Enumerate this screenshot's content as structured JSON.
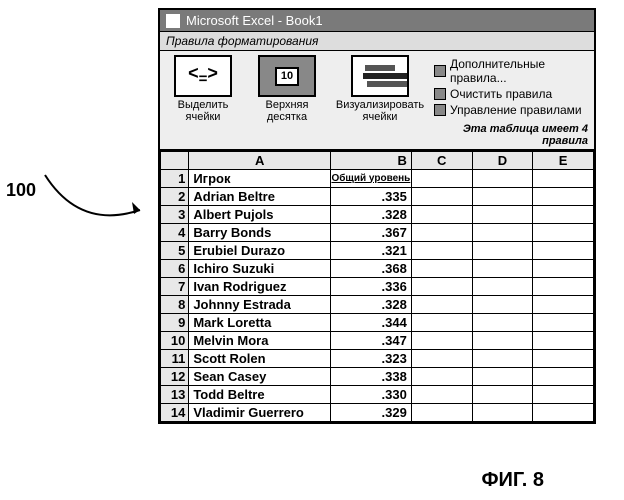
{
  "annotation": {
    "ref": "100",
    "fig": "ФИГ. 8"
  },
  "window": {
    "title": "Microsoft Excel - Book1",
    "ribbon_title": "Правила форматирования",
    "groups": {
      "highlight": {
        "label": "Выделить ячейки",
        "glyph": "< = >"
      },
      "top10": {
        "label": "Верхняя десятка",
        "glyph": "10"
      },
      "visualize": {
        "label": "Визуализировать ячейки"
      }
    },
    "links": {
      "more": "Дополнительные правила...",
      "clear": "Очистить правила",
      "manage": "Управление правилами"
    },
    "status": "Эта таблица имеет 4 правила"
  },
  "grid": {
    "columns": [
      "A",
      "B",
      "C",
      "D",
      "E"
    ],
    "headers": {
      "player": "Игрок",
      "level": "Общий уровень"
    },
    "rows": [
      {
        "n": 1
      },
      {
        "n": 2,
        "player": "Adrian Beltre",
        "val": ".335"
      },
      {
        "n": 3,
        "player": "Albert Pujols",
        "val": ".328"
      },
      {
        "n": 4,
        "player": "Barry Bonds",
        "val": ".367"
      },
      {
        "n": 5,
        "player": "Erubiel Durazo",
        "val": ".321"
      },
      {
        "n": 6,
        "player": "Ichiro Suzuki",
        "val": ".368"
      },
      {
        "n": 7,
        "player": "Ivan Rodriguez",
        "val": ".336"
      },
      {
        "n": 8,
        "player": "Johnny Estrada",
        "val": ".328"
      },
      {
        "n": 9,
        "player": "Mark Loretta",
        "val": ".344"
      },
      {
        "n": 10,
        "player": "Melvin Mora",
        "val": ".347"
      },
      {
        "n": 11,
        "player": "Scott Rolen",
        "val": ".323"
      },
      {
        "n": 12,
        "player": "Sean Casey",
        "val": ".338"
      },
      {
        "n": 13,
        "player": "Todd Beltre",
        "val": ".330"
      },
      {
        "n": 14,
        "player": "Vladimir Guerrero",
        "val": ".329"
      }
    ]
  }
}
